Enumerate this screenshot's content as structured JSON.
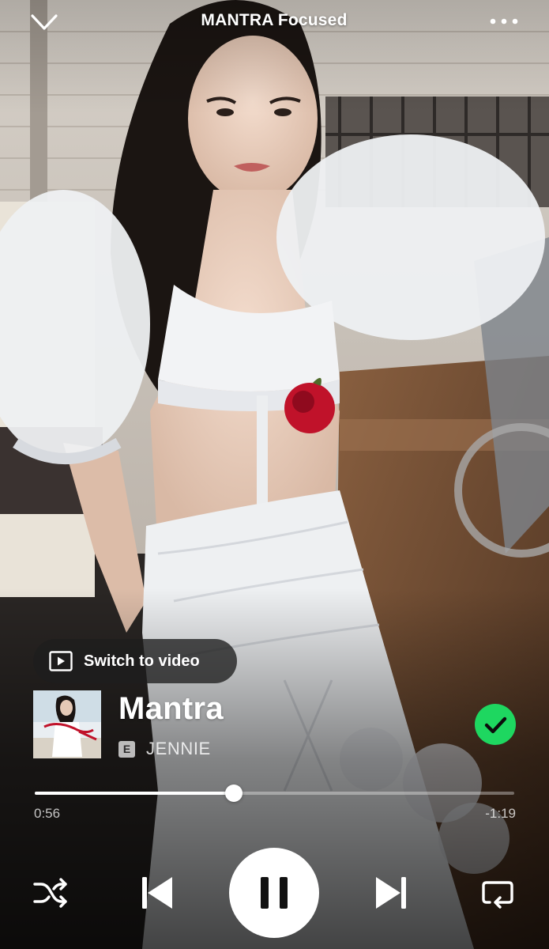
{
  "header": {
    "title": "MANTRA Focused",
    "collapse_icon": "chevron-down-icon",
    "more_icon": "more-horizontal-icon"
  },
  "switch_video": {
    "label": "Switch to video",
    "icon": "video-play-icon"
  },
  "track": {
    "title": "Mantra",
    "explicit_badge": "E",
    "artist": "JENNIE",
    "liked": true,
    "cover_alt_text": "Mantra"
  },
  "progress": {
    "elapsed": "0:56",
    "remaining": "-1:19",
    "fraction": 0.415
  },
  "controls": {
    "shuffle_icon": "shuffle-icon",
    "previous_icon": "skip-previous-icon",
    "play_state": "playing",
    "pause_icon": "pause-icon",
    "next_icon": "skip-next-icon",
    "repeat_icon": "repeat-icon"
  },
  "colors": {
    "accent_green": "#1ed760",
    "text": "#ffffff",
    "dress_white": "#eef0f2",
    "wall": "#c9c2ba",
    "car_interior": "#6e4a30",
    "rose": "#c0122a"
  }
}
